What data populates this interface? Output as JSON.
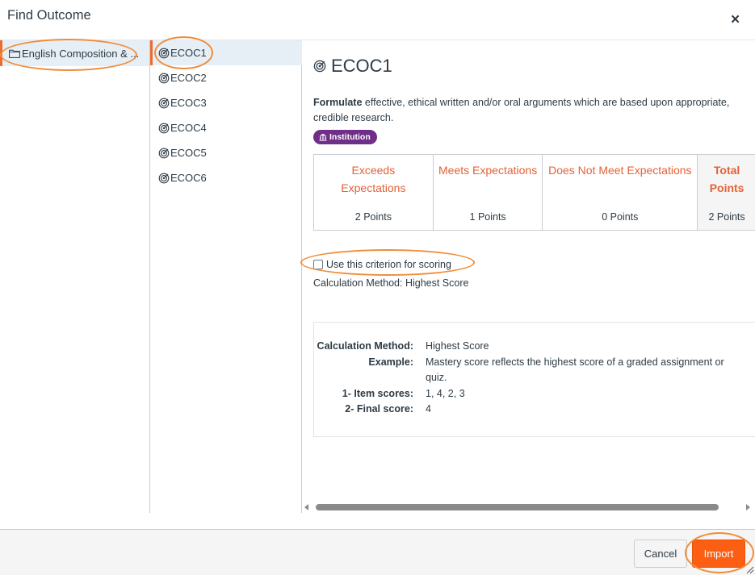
{
  "dialog": {
    "title": "Find Outcome",
    "close_label": "×"
  },
  "groups": [
    {
      "label": "English Composition & ..."
    }
  ],
  "outcomes": [
    {
      "label": "ECOC1"
    },
    {
      "label": "ECOC2"
    },
    {
      "label": "ECOC3"
    },
    {
      "label": "ECOC4"
    },
    {
      "label": "ECOC5"
    },
    {
      "label": "ECOC6"
    }
  ],
  "detail": {
    "title": "ECOC1",
    "description_bold": "Formulate",
    "description_rest": " effective, ethical written and/or oral arguments which are based upon appropriate, credible research.",
    "badge": "Institution",
    "rubric": [
      {
        "name": "Exceeds Expectations",
        "points": "2 Points"
      },
      {
        "name": "Meets Expectations",
        "points": "1 Points"
      },
      {
        "name": "Does Not Meet Expectations",
        "points": "0 Points"
      },
      {
        "name": "Total Points",
        "points": "2 Points"
      }
    ],
    "checkbox_label": "Use this criterion for scoring",
    "calculation_line": "Calculation Method: Highest Score",
    "calc_box": {
      "method_label": "Calculation Method:",
      "method_value": "Highest Score",
      "example_label": "Example:",
      "example_value": "Mastery score reflects the highest score of a graded assignment or quiz.",
      "item_scores_label": "1- Item scores:",
      "item_scores_value": "1, 4, 2, 3",
      "final_score_label": "2- Final score:",
      "final_score_value": "4"
    }
  },
  "footer": {
    "cancel_label": "Cancel",
    "import_label": "Import"
  },
  "colors": {
    "accent": "#ec6b2d",
    "rubric_text": "#e66135",
    "import_button": "#fc5e13",
    "badge": "#6f2e87",
    "highlight": "#f08d3a",
    "selected_bg": "#e6eff6"
  }
}
